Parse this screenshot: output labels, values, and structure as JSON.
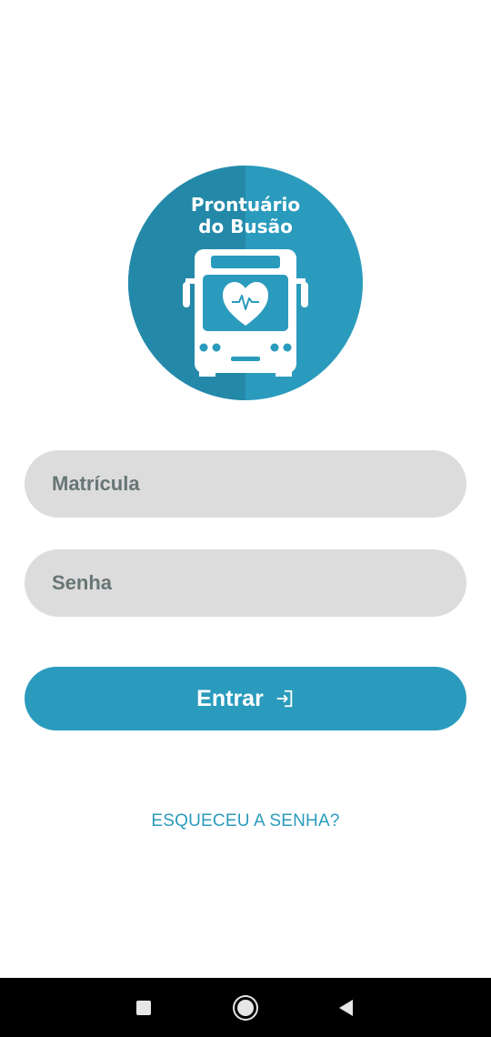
{
  "logo": {
    "line1": "Prontuário",
    "line2": "do Busão",
    "colors": {
      "light": "#2a9bbd",
      "dark": "#2489a9"
    },
    "icons": [
      "bus-icon",
      "heart-pulse-icon"
    ]
  },
  "form": {
    "matricula_placeholder": "Matrícula",
    "senha_placeholder": "Senha",
    "matricula_value": "",
    "senha_value": ""
  },
  "login_button": {
    "label": "Entrar",
    "icon": "login-arrow-icon",
    "color": "#2a9bbd"
  },
  "forgot_password": {
    "label": "ESQUECEU A SENHA?"
  },
  "navbar": {
    "icons": [
      "recent-apps-icon",
      "home-icon",
      "back-icon"
    ]
  },
  "colors": {
    "accent": "#2a9bbd",
    "field_background": "#dcdcdc",
    "placeholder": "#687575"
  }
}
